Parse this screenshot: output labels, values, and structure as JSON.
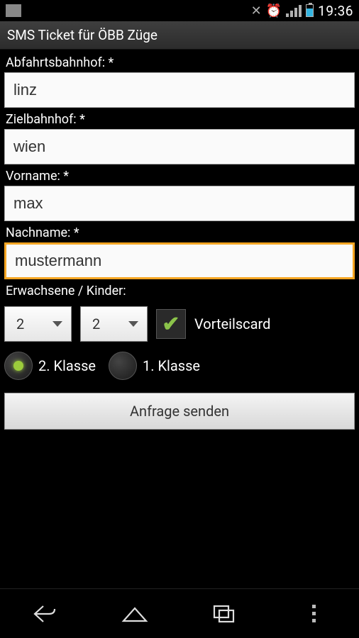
{
  "status": {
    "time": "19:36"
  },
  "title": "SMS Ticket für ÖBB Züge",
  "form": {
    "departure": {
      "label": "Abfahrtsbahnhof: *",
      "value": "linz"
    },
    "destination": {
      "label": "Zielbahnhof: *",
      "value": "wien"
    },
    "firstname": {
      "label": "Vorname: *",
      "value": "max"
    },
    "lastname": {
      "label": "Nachname: *",
      "value": "mustermann"
    },
    "passengers_label": "Erwachsene / Kinder:",
    "adults": "2",
    "children": "2",
    "vorteilscard_label": "Vorteilscard",
    "class2_label": "2. Klasse",
    "class1_label": "1. Klasse",
    "submit_label": "Anfrage senden"
  }
}
